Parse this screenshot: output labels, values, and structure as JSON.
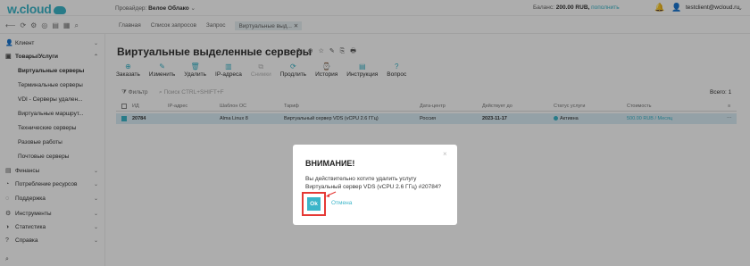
{
  "header": {
    "logo": "w.cloud",
    "provider_label": "Провайдер:",
    "provider_name": "Велое Облако",
    "balance_label": "Баланс:",
    "balance_value": "200.00 RUB,",
    "balance_link": "пополнить",
    "user_email": "testclient@wcloud.ru"
  },
  "breadcrumbs": [
    "Главная",
    "Список запросов",
    "Запрос",
    "Виртуальные выд..."
  ],
  "sidebar": {
    "client": "Клиент",
    "goods": "Товары/Услуги",
    "sub": [
      "Виртуальные серверы",
      "Терминальные серверы",
      "VDI - Серверы удален...",
      "Виртуальные маршрут...",
      "Технические серверы",
      "Разовые работы",
      "Почтовые серверы"
    ],
    "items": [
      "Финансы",
      "Потребление ресурсов",
      "Поддержка",
      "Инструменты",
      "Статистика",
      "Справка"
    ]
  },
  "page": {
    "title": "Виртуальные выделенные серверы",
    "title_icons": "↻ ⊕ ☆ ✎ ⎘ 🖶"
  },
  "toolbar": [
    {
      "label": "Заказать",
      "icon": "⊕",
      "disabled": false
    },
    {
      "label": "Изменить",
      "icon": "✎",
      "disabled": false
    },
    {
      "label": "Удалить",
      "icon": "🗑",
      "disabled": false
    },
    {
      "label": "IP-адреса",
      "icon": "▥",
      "disabled": false
    },
    {
      "label": "Снимки",
      "icon": "⧉",
      "disabled": true
    },
    {
      "label": "Продлить",
      "icon": "⟳",
      "disabled": false
    },
    {
      "label": "История",
      "icon": "⌚",
      "disabled": false
    },
    {
      "label": "Инструкция",
      "icon": "▤",
      "disabled": false
    },
    {
      "label": "Вопрос",
      "icon": "?",
      "disabled": false
    }
  ],
  "filter": {
    "label": "Фильтр",
    "placeholder": "Поиск CTRL+SHIFT+F",
    "total": "Всего: 1"
  },
  "table": {
    "headers": [
      "ИД",
      "IP-адрес",
      "Шаблон ОС",
      "Тариф",
      "Дата-центр",
      "Действует до",
      "Статус услуги",
      "Стоимость"
    ],
    "rows": [
      {
        "id": "20784",
        "ip": "",
        "os": "Alma Linux 8",
        "tariff": "Виртуальный сервер VDS (vCPU 2.6 ГГц)",
        "dc": "Россия",
        "expires": "2023-11-17",
        "status": "Активна",
        "price": "500.00 RUB / Месяц"
      }
    ]
  },
  "modal": {
    "title": "ВНИМАНИЕ!",
    "text": "Вы действительно хотите удалить услугу Виртуальный сервер VDS (vCPU 2.6 ГГц) #20784?",
    "ok": "Ok",
    "cancel": "Отмена",
    "close": "×"
  }
}
